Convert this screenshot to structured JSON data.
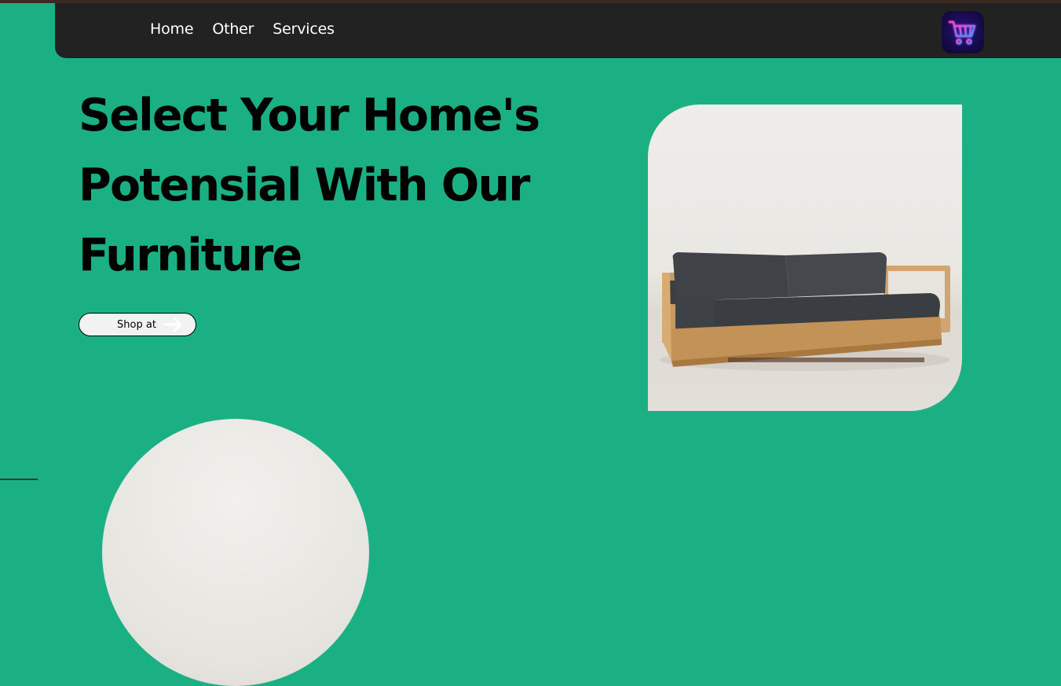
{
  "nav": {
    "links": [
      "Home",
      "Other",
      "Services"
    ],
    "cart_icon": "shopping-cart-icon"
  },
  "hero": {
    "title": "Select Your Home's Potensial With Our Furniture",
    "cta_label": "Shop at",
    "cta_icon": "arrow-right-icon"
  },
  "product": {
    "image": "wooden-frame-sofa-image"
  },
  "colors": {
    "background": "#1bb084",
    "navbar": "#222222",
    "cart_neon_pink": "#ff3fd0",
    "cart_neon_blue": "#4f8bff"
  }
}
